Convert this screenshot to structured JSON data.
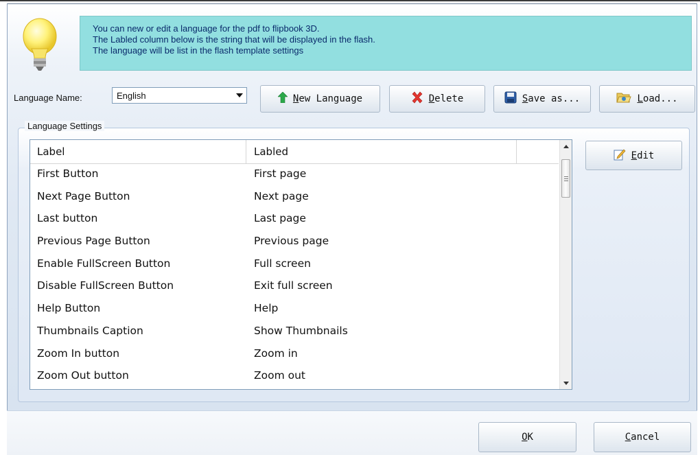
{
  "info": {
    "lines": [
      "You can new or edit  a language for the pdf to flipbook 3D.",
      "The Labled column below is the string that will be displayed in the flash.",
      "The language will be list in the flash template settings"
    ]
  },
  "toolbar": {
    "language_name_label": "Language Name:",
    "language_value": "English",
    "new_language": {
      "underline": "N",
      "rest": "ew Language"
    },
    "delete": {
      "underline": "D",
      "rest": "elete"
    },
    "save_as": {
      "underline": "S",
      "rest": "ave as..."
    },
    "load": {
      "underline": "L",
      "rest": "oad..."
    }
  },
  "settings": {
    "group_title": "Language Settings",
    "columns": [
      "Label",
      "Labled"
    ],
    "edit": {
      "underline": "E",
      "rest": "dit"
    },
    "rows": [
      [
        "First Button",
        "First page"
      ],
      [
        "Next Page Button",
        "Next page"
      ],
      [
        "Last button",
        "Last page"
      ],
      [
        "Previous Page Button",
        "Previous page"
      ],
      [
        "Enable FullScreen Button",
        "Full screen"
      ],
      [
        "Disable FullScreen Button",
        "Exit full screen"
      ],
      [
        "Help Button",
        "Help"
      ],
      [
        "Thumbnails Caption",
        "Show Thumbnails"
      ],
      [
        "Zoom In button",
        "Zoom in"
      ],
      [
        "Zoom Out button",
        "Zoom out"
      ]
    ]
  },
  "footer": {
    "ok": {
      "underline": "O",
      "rest": "K"
    },
    "cancel": {
      "underline": "C",
      "rest": "ancel"
    }
  },
  "icons": {
    "info": "lightbulb-icon",
    "new_language": "green-up-arrow-icon",
    "delete": "red-x-icon",
    "save_as": "floppy-disk-icon",
    "load": "folder-open-icon",
    "edit": "edit-pencil-icon"
  }
}
